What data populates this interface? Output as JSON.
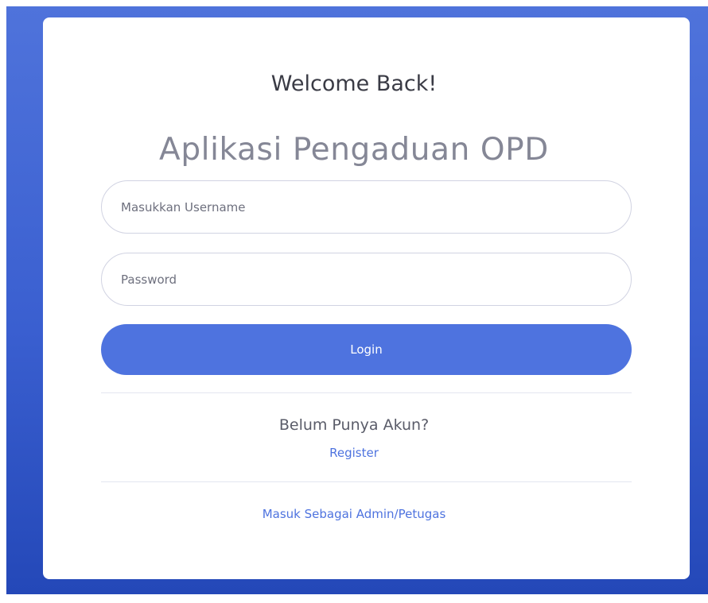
{
  "login": {
    "welcome": "Welcome Back!",
    "app_title": "Aplikasi Pengaduan OPD",
    "username_placeholder": "Masukkan Username",
    "username_value": "",
    "password_placeholder": "Password",
    "password_value": "",
    "login_label": "Login",
    "no_account_text": "Belum Punya Akun?",
    "register_label": "Register",
    "admin_link_label": "Masuk Sebagai Admin/Petugas"
  },
  "colors": {
    "primary": "#4e73df",
    "background_gradient_top": "#4f73db",
    "background_gradient_bottom": "#2448b8",
    "card": "#ffffff"
  }
}
